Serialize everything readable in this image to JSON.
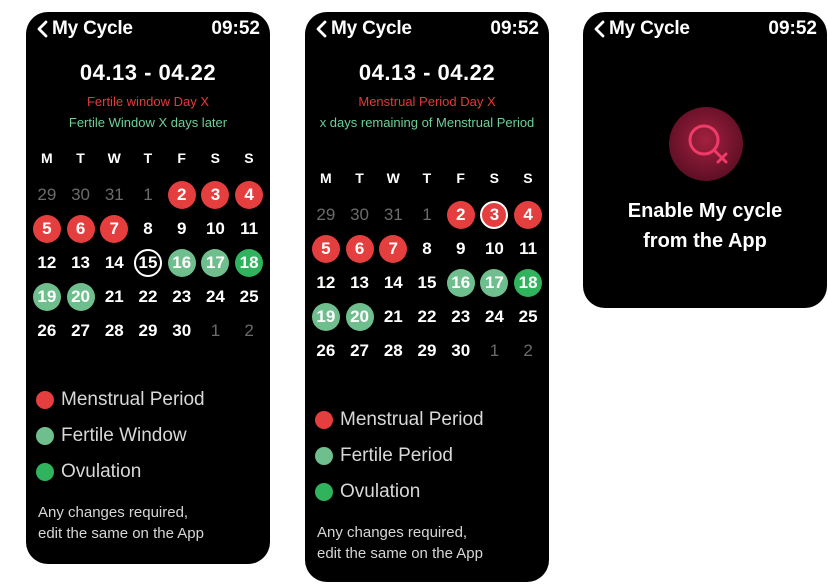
{
  "screens": [
    {
      "header": {
        "title": "My Cycle",
        "time": "09:52"
      },
      "date_range": "04.13 - 04.22",
      "status_line": "Fertile window Day X",
      "info_line": "Fertile Window X days later",
      "weekdays": [
        "M",
        "T",
        "W",
        "T",
        "F",
        "S",
        "S"
      ],
      "days": [
        {
          "n": "29",
          "s": "muted"
        },
        {
          "n": "30",
          "s": "muted"
        },
        {
          "n": "31",
          "s": "muted"
        },
        {
          "n": "1",
          "s": "muted"
        },
        {
          "n": "2",
          "s": "menstrual"
        },
        {
          "n": "3",
          "s": "menstrual"
        },
        {
          "n": "4",
          "s": "menstrual"
        },
        {
          "n": "5",
          "s": "menstrual"
        },
        {
          "n": "6",
          "s": "menstrual"
        },
        {
          "n": "7",
          "s": "menstrual"
        },
        {
          "n": "8",
          "s": ""
        },
        {
          "n": "9",
          "s": ""
        },
        {
          "n": "10",
          "s": ""
        },
        {
          "n": "11",
          "s": ""
        },
        {
          "n": "12",
          "s": ""
        },
        {
          "n": "13",
          "s": ""
        },
        {
          "n": "14",
          "s": ""
        },
        {
          "n": "15",
          "s": "today"
        },
        {
          "n": "16",
          "s": "fertile"
        },
        {
          "n": "17",
          "s": "fertile"
        },
        {
          "n": "18",
          "s": "ovulation"
        },
        {
          "n": "19",
          "s": "fertile"
        },
        {
          "n": "20",
          "s": "fertile"
        },
        {
          "n": "21",
          "s": ""
        },
        {
          "n": "22",
          "s": ""
        },
        {
          "n": "23",
          "s": ""
        },
        {
          "n": "24",
          "s": ""
        },
        {
          "n": "25",
          "s": ""
        },
        {
          "n": "26",
          "s": ""
        },
        {
          "n": "27",
          "s": ""
        },
        {
          "n": "28",
          "s": ""
        },
        {
          "n": "29",
          "s": ""
        },
        {
          "n": "30",
          "s": ""
        },
        {
          "n": "1",
          "s": "muted"
        },
        {
          "n": "2",
          "s": "muted"
        }
      ],
      "legend": [
        {
          "label": "Menstrual Period",
          "color": "#e53e3e"
        },
        {
          "label": "Fertile Window",
          "color": "#6fbf8e"
        },
        {
          "label": "Ovulation",
          "color": "#2fb35c"
        }
      ],
      "footer": [
        "Any changes required,",
        "edit the same on the App"
      ]
    },
    {
      "header": {
        "title": "My Cycle",
        "time": "09:52"
      },
      "date_range": "04.13 - 04.22",
      "status_line": "Menstrual Period Day X",
      "info_line": "x days remaining of Menstrual Period",
      "weekdays": [
        "M",
        "T",
        "W",
        "T",
        "F",
        "S",
        "S"
      ],
      "days": [
        {
          "n": "29",
          "s": "muted"
        },
        {
          "n": "30",
          "s": "muted"
        },
        {
          "n": "31",
          "s": "muted"
        },
        {
          "n": "1",
          "s": "muted"
        },
        {
          "n": "2",
          "s": "menstrual"
        },
        {
          "n": "3",
          "s": "menstrual today"
        },
        {
          "n": "4",
          "s": "menstrual"
        },
        {
          "n": "5",
          "s": "menstrual"
        },
        {
          "n": "6",
          "s": "menstrual"
        },
        {
          "n": "7",
          "s": "menstrual"
        },
        {
          "n": "8",
          "s": ""
        },
        {
          "n": "9",
          "s": ""
        },
        {
          "n": "10",
          "s": ""
        },
        {
          "n": "11",
          "s": ""
        },
        {
          "n": "12",
          "s": ""
        },
        {
          "n": "13",
          "s": ""
        },
        {
          "n": "14",
          "s": ""
        },
        {
          "n": "15",
          "s": ""
        },
        {
          "n": "16",
          "s": "fertile"
        },
        {
          "n": "17",
          "s": "fertile"
        },
        {
          "n": "18",
          "s": "ovulation"
        },
        {
          "n": "19",
          "s": "fertile"
        },
        {
          "n": "20",
          "s": "fertile"
        },
        {
          "n": "21",
          "s": ""
        },
        {
          "n": "22",
          "s": ""
        },
        {
          "n": "23",
          "s": ""
        },
        {
          "n": "24",
          "s": ""
        },
        {
          "n": "25",
          "s": ""
        },
        {
          "n": "26",
          "s": ""
        },
        {
          "n": "27",
          "s": ""
        },
        {
          "n": "28",
          "s": ""
        },
        {
          "n": "29",
          "s": ""
        },
        {
          "n": "30",
          "s": ""
        },
        {
          "n": "1",
          "s": "muted"
        },
        {
          "n": "2",
          "s": "muted"
        }
      ],
      "legend": [
        {
          "label": "Menstrual Period",
          "color": "#e53e3e"
        },
        {
          "label": "Fertile Period",
          "color": "#6fbf8e"
        },
        {
          "label": "Ovulation",
          "color": "#2fb35c"
        }
      ],
      "footer": [
        "Any changes required,",
        "edit the same on the App"
      ]
    },
    {
      "header": {
        "title": "My Cycle",
        "time": "09:52"
      },
      "icon": "female-cycle-icon",
      "message": [
        "Enable My cycle",
        "from the App"
      ]
    }
  ]
}
